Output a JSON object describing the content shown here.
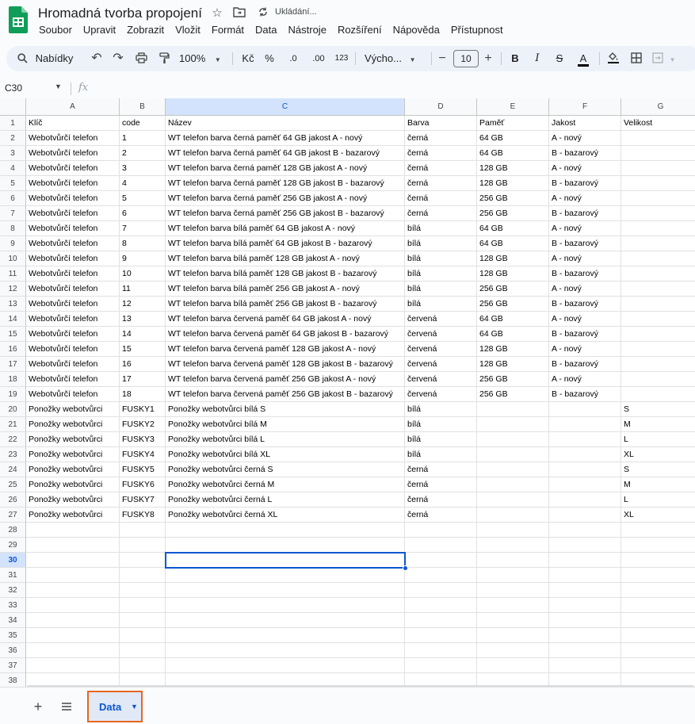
{
  "app": {
    "title": "Hromadná tvorba propojení",
    "saving_status": "Ukládání..."
  },
  "menu": [
    "Soubor",
    "Upravit",
    "Zobrazit",
    "Vložit",
    "Formát",
    "Data",
    "Nástroje",
    "Rozšíření",
    "Nápověda",
    "Přístupnost"
  ],
  "toolbar": {
    "search_label": "Nabídky",
    "zoom": "100%",
    "currency": "Kč",
    "percent": "%",
    "decrease_decimal": ".0",
    "increase_decimal": ".00",
    "number_format": "123",
    "font": "Výcho...",
    "font_size": "10",
    "bold": "B",
    "italic": "I",
    "strikethrough": "S",
    "text_color": "A"
  },
  "formula_bar": {
    "cell_ref": "C30",
    "fx": "fx"
  },
  "columns": [
    "A",
    "B",
    "C",
    "D",
    "E",
    "F",
    "G"
  ],
  "selected_column": "C",
  "selected_row": "30",
  "headers": [
    "Klíč",
    "code",
    "Název",
    "Barva",
    "Paměť",
    "Jakost",
    "Velikost"
  ],
  "rows": [
    [
      "Webotvůrčí telefon",
      "1",
      "WT telefon barva černá paměť 64 GB jakost A - nový",
      "černá",
      "64 GB",
      "A - nový",
      ""
    ],
    [
      "Webotvůrčí telefon",
      "2",
      "WT telefon barva černá paměť 64 GB jakost B - bazarový",
      "černá",
      "64 GB",
      "B - bazarový",
      ""
    ],
    [
      "Webotvůrčí telefon",
      "3",
      "WT telefon barva černá paměť 128 GB jakost A - nový",
      "černá",
      "128 GB",
      "A - nový",
      ""
    ],
    [
      "Webotvůrčí telefon",
      "4",
      "WT telefon barva černá paměť 128 GB jakost B - bazarový",
      "černá",
      "128 GB",
      "B - bazarový",
      ""
    ],
    [
      "Webotvůrčí telefon",
      "5",
      "WT telefon barva černá paměť 256 GB jakost A - nový",
      "černá",
      "256 GB",
      "A - nový",
      ""
    ],
    [
      "Webotvůrčí telefon",
      "6",
      "WT telefon barva černá paměť 256 GB jakost B - bazarový",
      "černá",
      "256 GB",
      "B - bazarový",
      ""
    ],
    [
      "Webotvůrčí telefon",
      "7",
      "WT telefon barva bílá paměť 64 GB jakost A - nový",
      "bílá",
      "64 GB",
      "A - nový",
      ""
    ],
    [
      "Webotvůrčí telefon",
      "8",
      "WT telefon barva bílá paměť 64 GB jakost B - bazarový",
      "bílá",
      "64 GB",
      "B - bazarový",
      ""
    ],
    [
      "Webotvůrčí telefon",
      "9",
      "WT telefon barva bílá paměť 128 GB jakost A - nový",
      "bílá",
      "128 GB",
      "A - nový",
      ""
    ],
    [
      "Webotvůrčí telefon",
      "10",
      "WT telefon barva bílá paměť 128 GB jakost B - bazarový",
      "bílá",
      "128 GB",
      "B - bazarový",
      ""
    ],
    [
      "Webotvůrčí telefon",
      "11",
      "WT telefon barva bílá paměť 256 GB jakost A - nový",
      "bílá",
      "256 GB",
      "A - nový",
      ""
    ],
    [
      "Webotvůrčí telefon",
      "12",
      "WT telefon barva bílá paměť 256 GB jakost B - bazarový",
      "bílá",
      "256 GB",
      "B - bazarový",
      ""
    ],
    [
      "Webotvůrčí telefon",
      "13",
      "WT telefon barva červená paměť 64 GB jakost A - nový",
      "červená",
      "64 GB",
      "A - nový",
      ""
    ],
    [
      "Webotvůrčí telefon",
      "14",
      "WT telefon barva červená paměť 64 GB jakost B - bazarový",
      "červená",
      "64 GB",
      "B - bazarový",
      ""
    ],
    [
      "Webotvůrčí telefon",
      "15",
      "WT telefon barva červená paměť 128 GB jakost A - nový",
      "červená",
      "128 GB",
      "A - nový",
      ""
    ],
    [
      "Webotvůrčí telefon",
      "16",
      "WT telefon barva červená paměť 128 GB jakost B - bazarový",
      "červená",
      "128 GB",
      "B - bazarový",
      ""
    ],
    [
      "Webotvůrčí telefon",
      "17",
      "WT telefon barva červená paměť 256 GB jakost A - nový",
      "červená",
      "256 GB",
      "A - nový",
      ""
    ],
    [
      "Webotvůrčí telefon",
      "18",
      "WT telefon barva červená paměť 256 GB jakost B - bazarový",
      "červená",
      "256 GB",
      "B - bazarový",
      ""
    ],
    [
      "Ponožky webotvůrci",
      "FUSKY1",
      "Ponožky webotvůrci bílá S",
      "bílá",
      "",
      "",
      "S"
    ],
    [
      "Ponožky webotvůrci",
      "FUSKY2",
      "Ponožky webotvůrci bílá M",
      "bílá",
      "",
      "",
      "M"
    ],
    [
      "Ponožky webotvůrci",
      "FUSKY3",
      "Ponožky webotvůrci bílá L",
      "bílá",
      "",
      "",
      "L"
    ],
    [
      "Ponožky webotvůrci",
      "FUSKY4",
      "Ponožky webotvůrci bílá XL",
      "bílá",
      "",
      "",
      "XL"
    ],
    [
      "Ponožky webotvůrci",
      "FUSKY5",
      "Ponožky webotvůrci černá S",
      "černá",
      "",
      "",
      "S"
    ],
    [
      "Ponožky webotvůrci",
      "FUSKY6",
      "Ponožky webotvůrci černá M",
      "černá",
      "",
      "",
      "M"
    ],
    [
      "Ponožky webotvůrci",
      "FUSKY7",
      "Ponožky webotvůrci černá L",
      "černá",
      "",
      "",
      "L"
    ],
    [
      "Ponožky webotvůrci",
      "FUSKY8",
      "Ponožky webotvůrci černá XL",
      "černá",
      "",
      "",
      "XL"
    ]
  ],
  "visible_row_numbers": [
    "1",
    "2",
    "3",
    "4",
    "5",
    "6",
    "7",
    "8",
    "9",
    "10",
    "11",
    "12",
    "13",
    "14",
    "15",
    "16",
    "17",
    "18",
    "19",
    "20",
    "21",
    "22",
    "23",
    "24",
    "25",
    "26",
    "27",
    "28",
    "29",
    "30",
    "31",
    "32",
    "33",
    "34",
    "35",
    "36",
    "37",
    "38"
  ],
  "sheets": [
    {
      "name": "Data",
      "active": true
    }
  ],
  "colors": {
    "accent": "#0b57d0",
    "selection_bg": "#d3e3fd",
    "sheet_tab_highlight": "#e8661e",
    "logo_green": "#0f9d58"
  }
}
